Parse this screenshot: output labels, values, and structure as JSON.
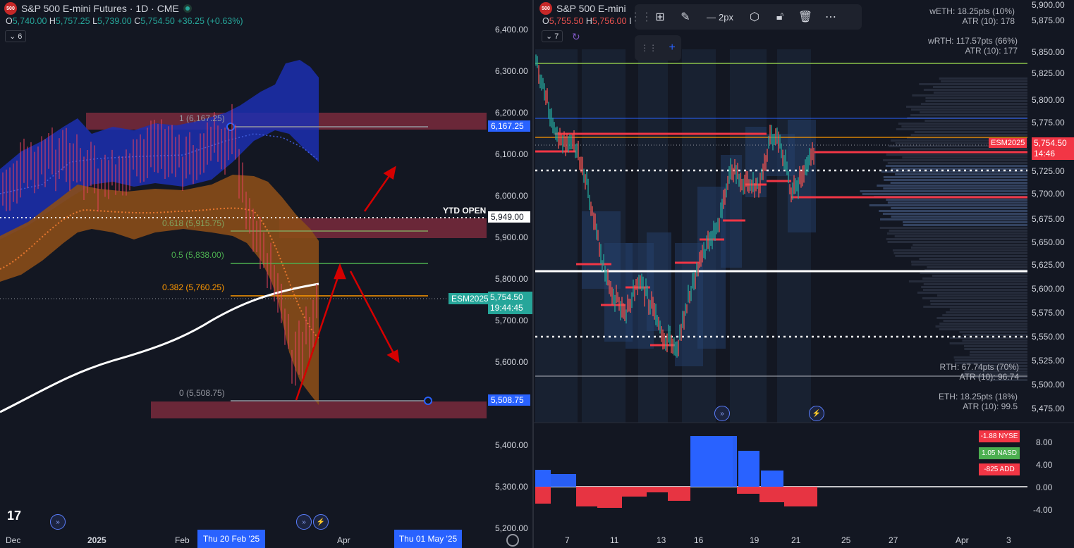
{
  "left": {
    "symbol_logo": "500",
    "title": "S&P 500 E-mini Futures · 1D · CME",
    "ohlc": {
      "o_label": "O",
      "o": "5,740.00",
      "h_label": "H",
      "h": "5,757.25",
      "l_label": "L",
      "l": "5,739.00",
      "c_label": "C",
      "c": "5,754.50",
      "change": "+36.25 (+0.63%)"
    },
    "indicator_count": "6",
    "price_axis": [
      "6,400.00",
      "6,300.00",
      "6,200.00",
      "6,100.00",
      "6,000.00",
      "5,900.00",
      "5,800.00",
      "5,700.00",
      "5,600.00",
      "5,400.00",
      "5,300.00",
      "5,200.00"
    ],
    "time_axis": [
      "Dec",
      "2025",
      "Feb",
      "Apr"
    ],
    "time_highlights": [
      "Thu 20 Feb '25",
      "Thu 01 May '25"
    ],
    "fib_levels": [
      {
        "label": "1 (6,167.25)",
        "color": "#9598a1"
      },
      {
        "label": "0.618 (5,915.75)",
        "color": "#82a35f"
      },
      {
        "label": "0.5 (5,838.00)",
        "color": "#4caf50"
      },
      {
        "label": "0.382 (5,760.25)",
        "color": "#ff9800"
      },
      {
        "label": "0 (5,508.75)",
        "color": "#9598a1"
      }
    ],
    "ytd_label": "YTD OPEN",
    "tags": {
      "fib_top": "6,167.25",
      "ytd": "5,949.00",
      "symbol": "ESM2025",
      "price": "5,754.50",
      "countdown": "19:44:45",
      "fib_bottom": "5,508.75"
    },
    "tv_logo": "17"
  },
  "right": {
    "symbol_logo": "500",
    "title": "S&P 500 E-mini",
    "ohlc": {
      "o": "5,755.50",
      "h_label": "H",
      "h": "5,756.00",
      "suffix": "I"
    },
    "indicator_count": "7",
    "toolbar": {
      "stroke_label": "2px"
    },
    "annotations": {
      "weth": "wETH: 18.25pts (10%)",
      "weth_atr": "ATR (10): 178",
      "wrth": "wRTH: 117.57pts (66%)",
      "wrth_atr": "ATR (10): 177",
      "rth": "RTH: 67.74pts (70%)",
      "rth_atr": "ATR (10): 96.74",
      "eth": "ETH: 18.25pts (18%)",
      "eth_atr": "ATR (10): 99.5"
    },
    "price_axis": [
      "5,900.00",
      "5,875.00",
      "5,850.00",
      "5,825.00",
      "5,800.00",
      "5,775.00",
      "5,725.00",
      "5,700.00",
      "5,675.00",
      "5,650.00",
      "5,625.00",
      "5,600.00",
      "5,575.00",
      "5,550.00",
      "5,525.00",
      "5,500.00",
      "5,475.00"
    ],
    "tags": {
      "symbol": "ESM2025",
      "price": "5,754.50",
      "countdown": "14:46"
    },
    "osc_axis": [
      "8.00",
      "4.00",
      "0.00",
      "-4.00"
    ],
    "breadth": [
      {
        "label": "-1.88 NYSE",
        "color": "#f23645"
      },
      {
        "label": "1.05 NASD",
        "color": "#4caf50"
      },
      {
        "label": "-825 ADD",
        "color": "#f23645"
      }
    ],
    "time_axis": [
      "7",
      "11",
      "13",
      "16",
      "19",
      "21",
      "25",
      "27",
      "Apr",
      "3"
    ]
  },
  "colors": {
    "bg": "#131722",
    "up": "#26a69a",
    "down": "#ef5350",
    "accent": "#2962ff"
  }
}
